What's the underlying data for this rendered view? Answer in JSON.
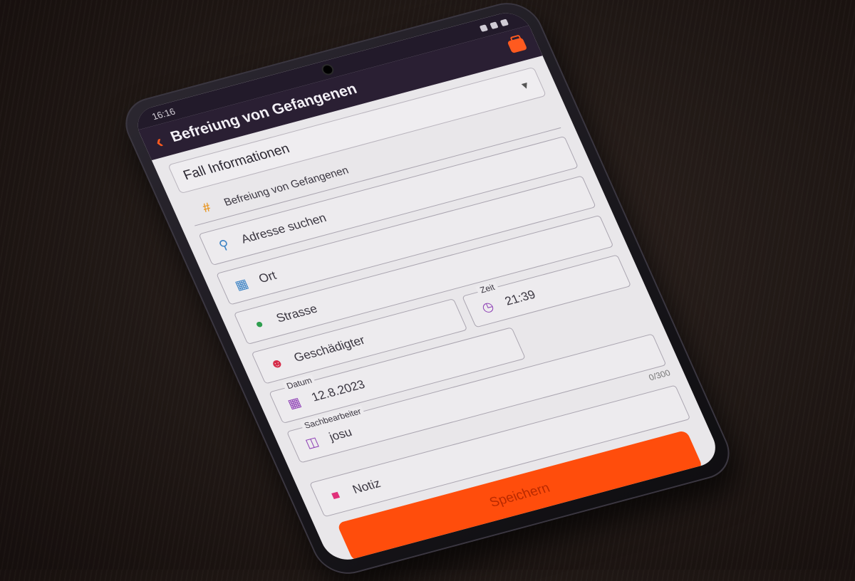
{
  "status_bar": {
    "time": "16:16"
  },
  "app_bar": {
    "title": "Befreiung von Gefangenen"
  },
  "section": {
    "title": "Fall Informationen"
  },
  "fields": {
    "case_type": {
      "value": "Befreiung von Gefangenen"
    },
    "address_search": {
      "placeholder": "Adresse suchen"
    },
    "city": {
      "placeholder": "Ort"
    },
    "street": {
      "placeholder": "Strasse"
    },
    "injured_party": {
      "placeholder": "Geschädigter"
    },
    "date": {
      "label": "Datum",
      "value": "12.8.2023"
    },
    "time": {
      "label": "Zeit",
      "value": "21:39"
    },
    "case_officer": {
      "label": "Sachbearbeiter",
      "value": "josu"
    },
    "note": {
      "placeholder": "Notiz",
      "counter": "0/300"
    }
  },
  "actions": {
    "save_label": "Speichern"
  },
  "colors": {
    "accent": "#ff4d0c",
    "app_bar": "#2a1f33"
  },
  "icons": [
    "back-arrow-icon",
    "toolbox-icon",
    "chevron-down-icon",
    "hash-icon",
    "search-icon",
    "city-icon",
    "location-pin-icon",
    "person-icon",
    "calendar-icon",
    "clock-icon",
    "hierarchy-icon",
    "note-icon"
  ]
}
